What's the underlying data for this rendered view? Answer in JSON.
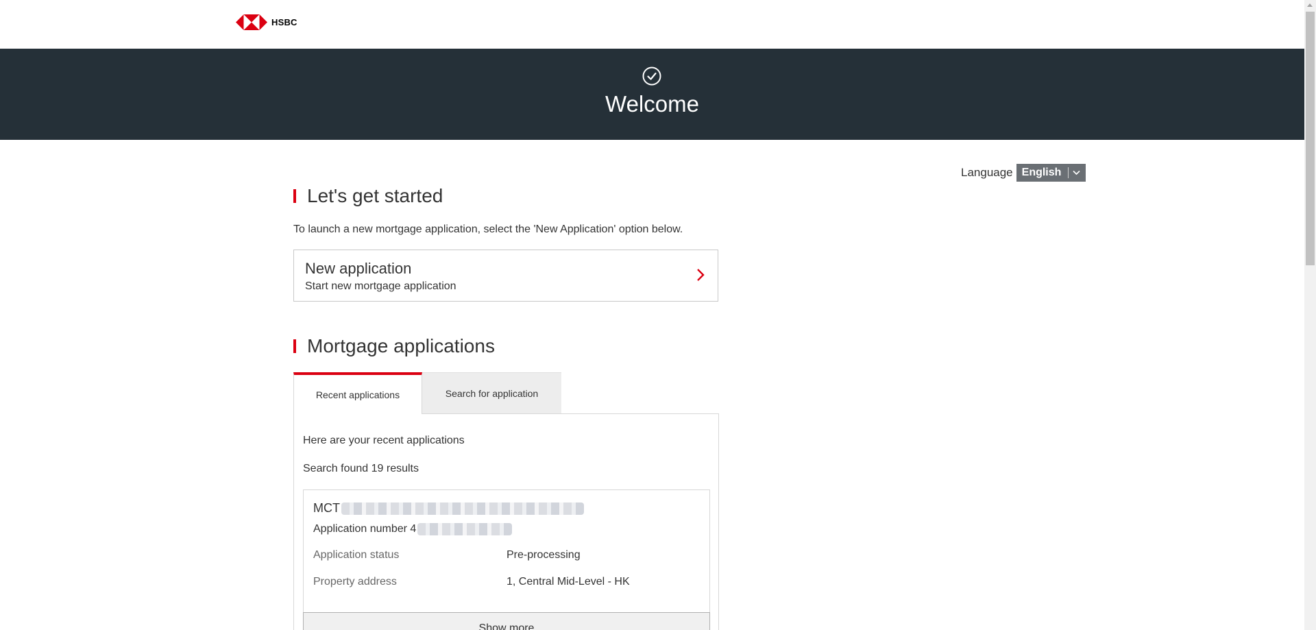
{
  "header": {
    "brand": "HSBC",
    "brand_color": "#db0011"
  },
  "banner": {
    "icon": "check-circle-icon",
    "title": "Welcome",
    "background": "#253038"
  },
  "language": {
    "label": "Language",
    "selected": "English",
    "icon": "chevron-down-icon"
  },
  "getting_started": {
    "heading": "Let's get started",
    "intro": "To launch a new mortgage application, select the 'New Application' option below.",
    "new_application": {
      "title": "New application",
      "subtitle": "Start new mortgage application",
      "icon": "chevron-right-icon"
    }
  },
  "applications": {
    "heading": "Mortgage applications",
    "tabs": [
      {
        "label": "Recent applications",
        "active": true
      },
      {
        "label": "Search for application",
        "active": false
      }
    ],
    "panel": {
      "intro": "Here are your recent applications",
      "count_text": "Search found 19 results",
      "results": [
        {
          "name": "MCT",
          "number_label": "Application number 4",
          "rows": [
            {
              "label": "Application status",
              "value": "Pre-processing"
            },
            {
              "label": "Property address",
              "value": "1, Central Mid-Level - HK"
            }
          ],
          "show_more": "Show more"
        }
      ]
    }
  },
  "colors": {
    "accent": "#db0011",
    "tab_inactive_bg": "#ededed",
    "language_bg": "#6a6f74"
  }
}
